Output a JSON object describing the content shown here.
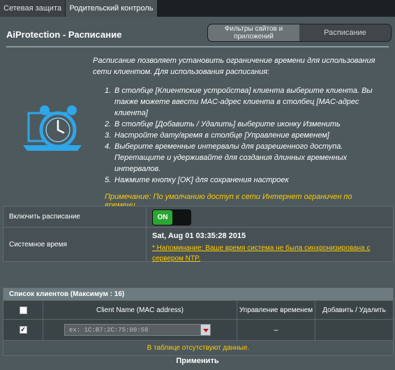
{
  "tabs": [
    {
      "label": "Сетевая защита",
      "active": false
    },
    {
      "label": "Родительский контроль",
      "active": true
    }
  ],
  "page_title": "AiProtection - Расписание",
  "switcher": {
    "filters_label": "Фильтры сайтов и приложений",
    "schedule_label": "Расписание"
  },
  "icon": "alarm-clock-laptop-icon",
  "description": "Расписание позволяет установить ограничение времени для использования сети клиентом. Для использования расписания:",
  "steps": [
    "В столбце [Клиентские устройства] клиента выберите клиента. Вы также можете ввести MAC-адрес клиента в столбец [MAC-адрес клиента]",
    "В столбце [Добавить / Удалить] выберите иконку Изменить",
    "Настройте дату/время в столбце [Управление временем]",
    "Выберите временные интервалы для разрешенного доступа. Перетащите и удерживайте для создания длинных временных интервалов.",
    "Нажмите кнопку [OK] для сохранения настроек"
  ],
  "note": "Примечание: По умолчанию доступ к сети Интернет ограничен по времени.",
  "settings": {
    "enable_label": "Включить расписание",
    "enable_state": "ON",
    "system_time_label": "Системное время",
    "system_time_value": "Sat, Aug 01 03:35:28 2015",
    "ntp_reminder": "* Напоминание: Ваше время система не была синхронизирована с сервером NTP."
  },
  "client_list": {
    "title": "Список клиентов (Максимум : 16)",
    "columns": [
      "Client Name (MAC address)",
      "Управление временем",
      "Добавить / Удалить"
    ],
    "mac_placeholder": "ex: 1C:B7:2C:75:00:58",
    "time_mgmt_value": "–",
    "empty_text": "В таблице отсутствуют данные."
  },
  "apply_label": "Применить",
  "colors": {
    "accent_yellow": "#ffcc00",
    "toggle_on": "#2aa732",
    "panel_bg": "#4d595d"
  }
}
